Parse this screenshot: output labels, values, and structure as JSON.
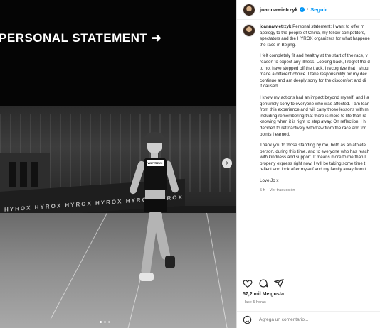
{
  "post": {
    "username": "joannawietrzyk",
    "follow_label": "Seguir",
    "separator": "•",
    "verified_mark": "✓"
  },
  "media": {
    "title": "PERSONAL STATEMENT ➜",
    "next_icon": "›",
    "barrier_text": "HYROX  HYROX  HYROX  HYROX  HYROX  HYROX",
    "bib_text": "WIETRZYK",
    "slide_count": 3,
    "active_slide": 1
  },
  "caption": {
    "username": "joannawietrzyk",
    "paragraphs": [
      [
        "Personal statement: I want to offer m",
        "apology to the people of China, my fellow competitors,",
        "spectators and the HYROX organizers for what happene",
        "the race in Beijing."
      ],
      [
        "I felt completely fit and healthy at the start of the race, v",
        "reason to expect any illness. Looking back, I regret the d",
        "to not have stepped off the track. I recognize that I shou",
        "made a different choice. I take responsibility for my dec",
        "continue and am deeply sorry for the discomfort and di",
        "it caused."
      ],
      [
        "I know my actions had an impact beyond myself, and I a",
        "genuinely sorry to everyone who was affected. I am lear",
        "from this experience and will carry those lessons with m",
        "including remembering that there is more to life than ra",
        "knowing when it is right to step away. On reflection, I h",
        "decided to retroactively withdraw from the race and for",
        "points I earned."
      ],
      [
        "Thank you to those standing by me, both as an athlete",
        "person, during this time, and to everyone who has reach",
        "with kindness and support. It means more to me than I",
        "properly express right now. I will be taking some time t",
        "reflect and look after myself and my family away from t"
      ],
      [
        "Love Jo x"
      ]
    ],
    "time": "5 h",
    "translation_link": "Ver traducción"
  },
  "actions": {
    "icons": [
      "heart-icon",
      "comment-icon",
      "share-icon"
    ]
  },
  "likes": "57,2 mil Me gusta",
  "posted_ago": "Hace 5 horas",
  "comment": {
    "placeholder": "Agrega un comentario..."
  }
}
